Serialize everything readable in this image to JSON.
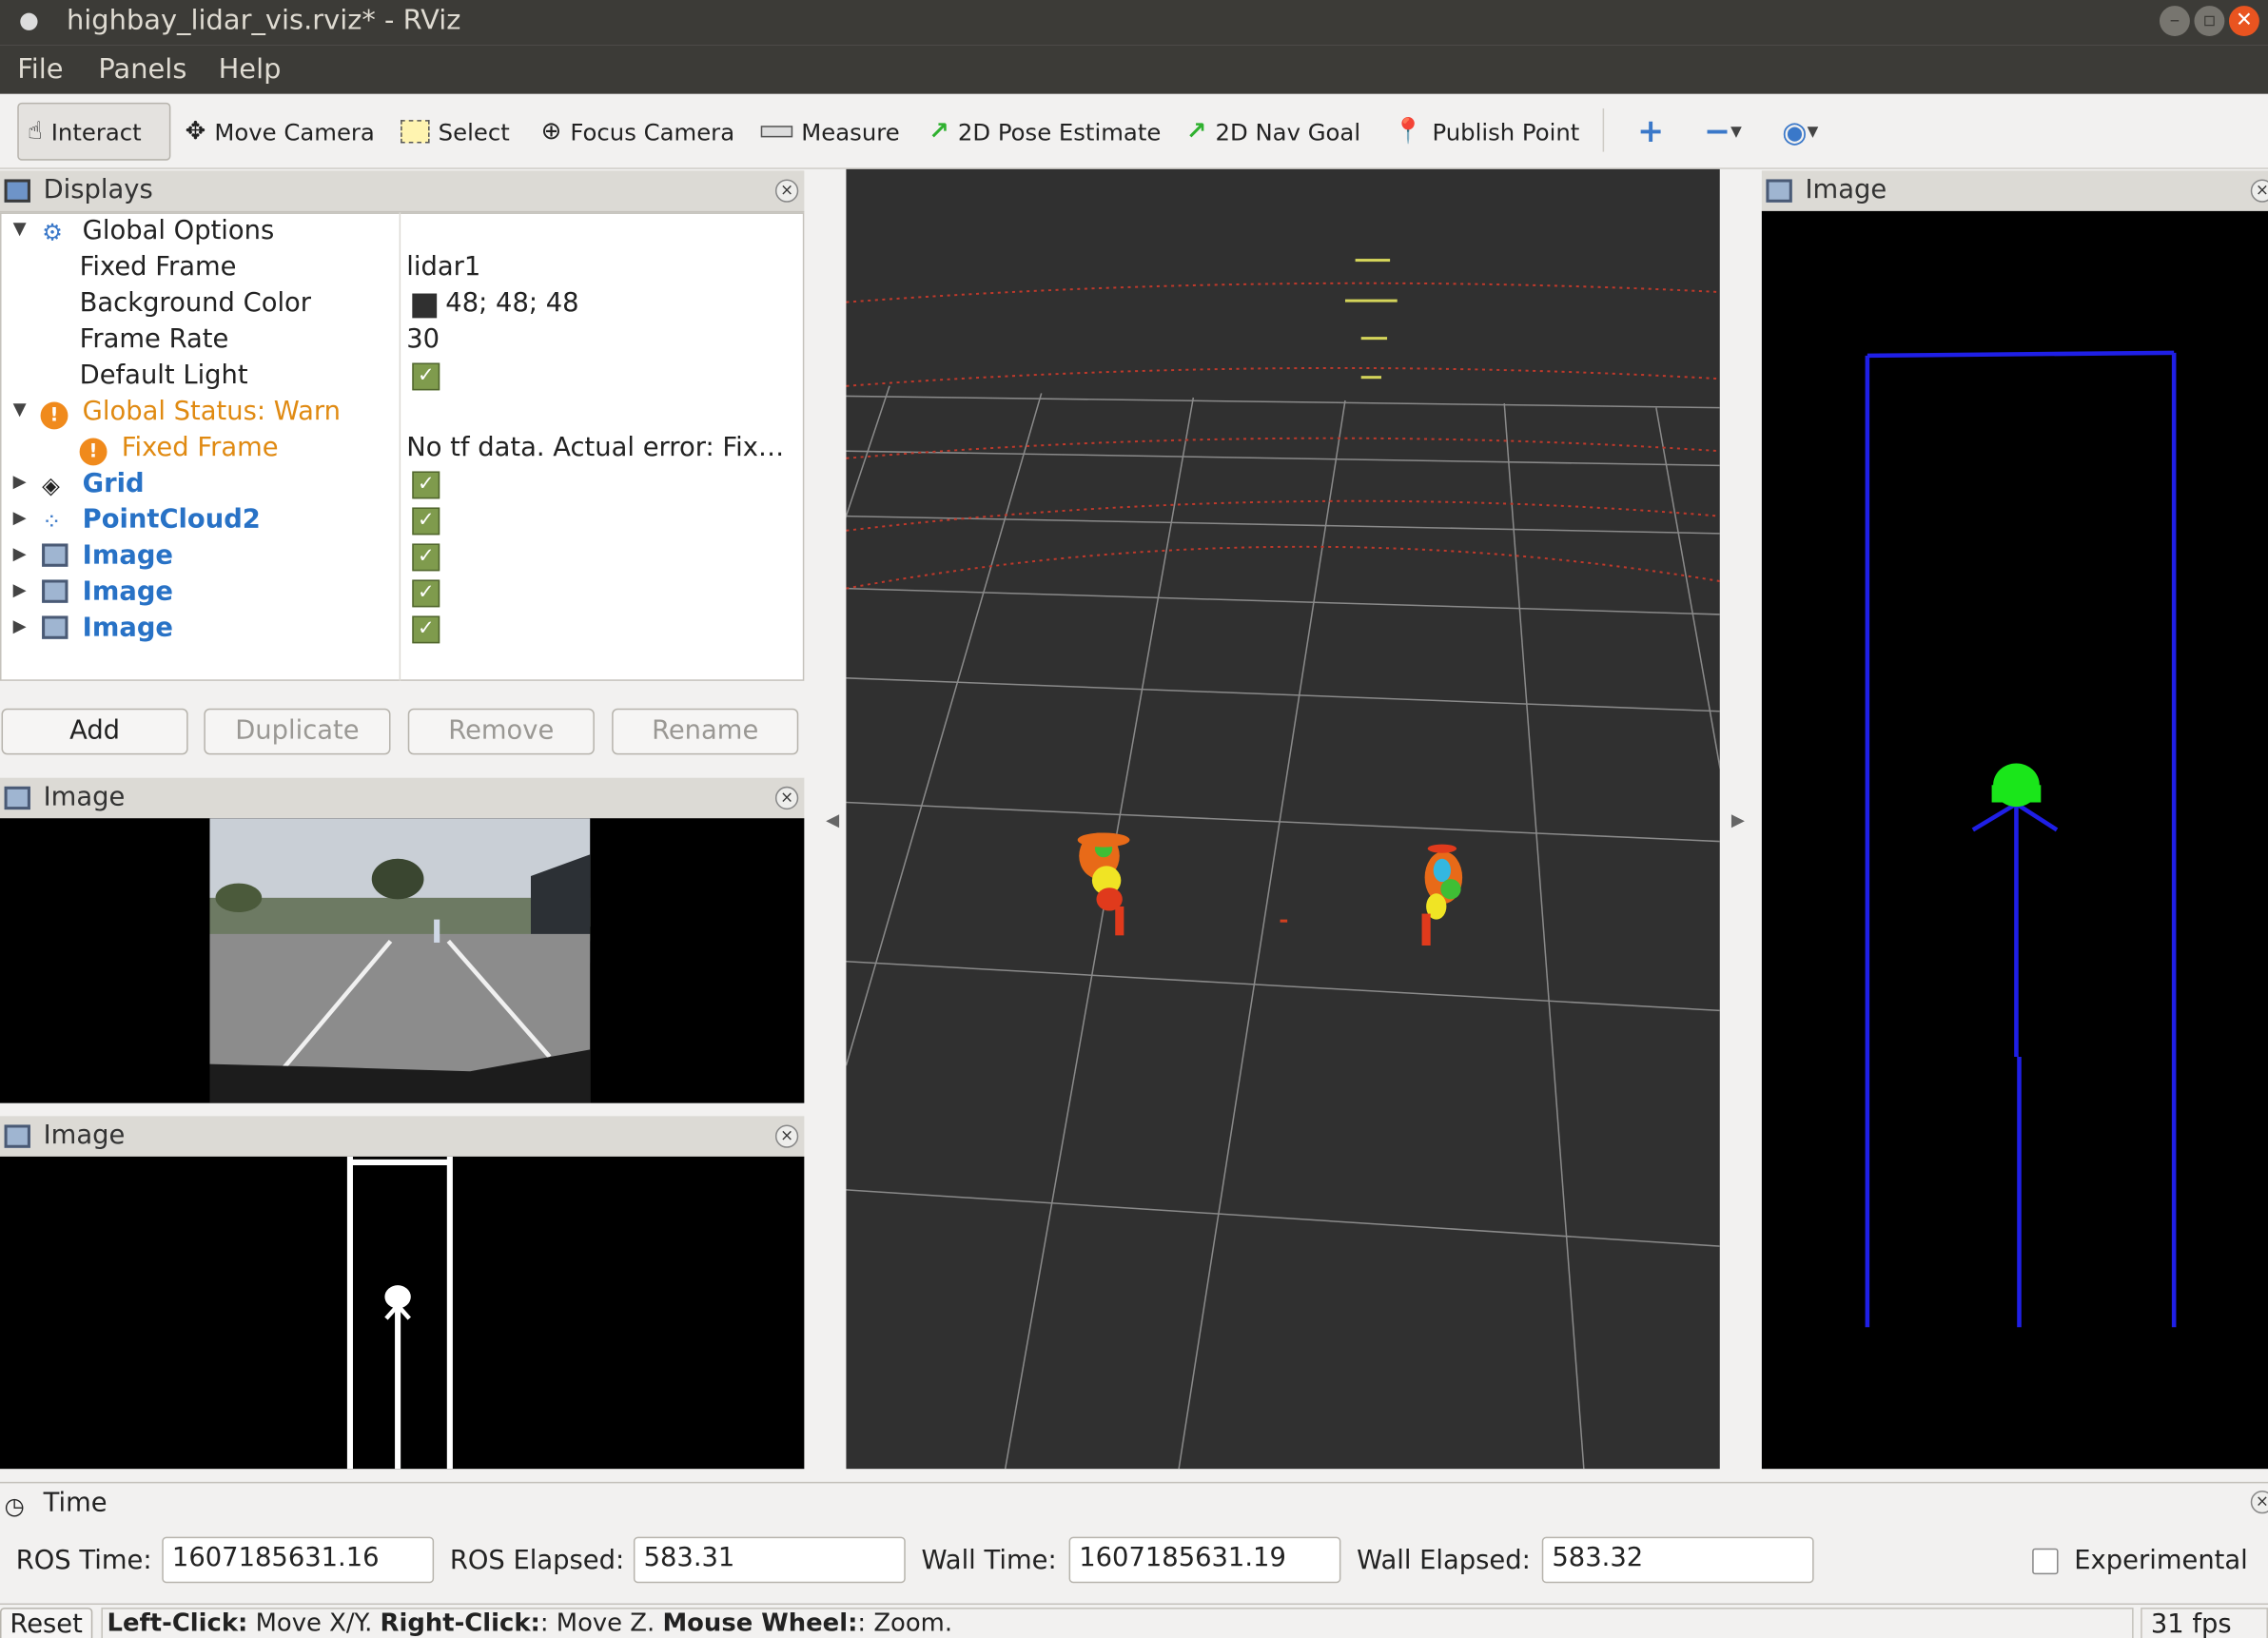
{
  "window": {
    "title": "highbay_lidar_vis.rviz* - RViz"
  },
  "menu": {
    "file": "File",
    "panels": "Panels",
    "help": "Help"
  },
  "toolbar": {
    "interact": "Interact",
    "move_camera": "Move Camera",
    "select": "Select",
    "focus_camera": "Focus Camera",
    "measure": "Measure",
    "pose_estimate": "2D Pose Estimate",
    "nav_goal": "2D Nav Goal",
    "publish_point": "Publish Point"
  },
  "displays": {
    "title": "Displays",
    "global_options": "Global Options",
    "fixed_frame_label": "Fixed Frame",
    "fixed_frame_value": "lidar1",
    "bg_color_label": "Background Color",
    "bg_color_value": "48; 48; 48",
    "frame_rate_label": "Frame Rate",
    "frame_rate_value": "30",
    "default_light_label": "Default Light",
    "global_status": "Global Status: Warn",
    "status_fixed_frame": "Fixed Frame",
    "status_error": "No tf data.  Actual error: Fix…",
    "grid": "Grid",
    "pointcloud": "PointCloud2",
    "image1": "Image",
    "image2": "Image",
    "image3": "Image"
  },
  "buttons": {
    "add": "Add",
    "duplicate": "Duplicate",
    "remove": "Remove",
    "rename": "Rename"
  },
  "panels": {
    "image_a": "Image",
    "image_b": "Image",
    "image_right": "Image"
  },
  "time": {
    "title": "Time",
    "ros_time_label": "ROS Time:",
    "ros_time": "1607185631.16",
    "ros_elapsed_label": "ROS Elapsed:",
    "ros_elapsed": "583.31",
    "wall_time_label": "Wall Time:",
    "wall_time": "1607185631.19",
    "wall_elapsed_label": "Wall Elapsed:",
    "wall_elapsed": "583.32",
    "experimental": "Experimental"
  },
  "status": {
    "reset": "Reset",
    "left_click": "Left-Click:",
    "left_action": " Move X/Y. ",
    "right_click": "Right-Click:",
    "right_action": ": Move Z. ",
    "wheel": "Mouse Wheel:",
    "wheel_action": ": Zoom.",
    "fps": "31 fps"
  },
  "colors": {
    "bg": "#303030",
    "accent_blue": "#2872c6",
    "warn": "#e08a12"
  }
}
